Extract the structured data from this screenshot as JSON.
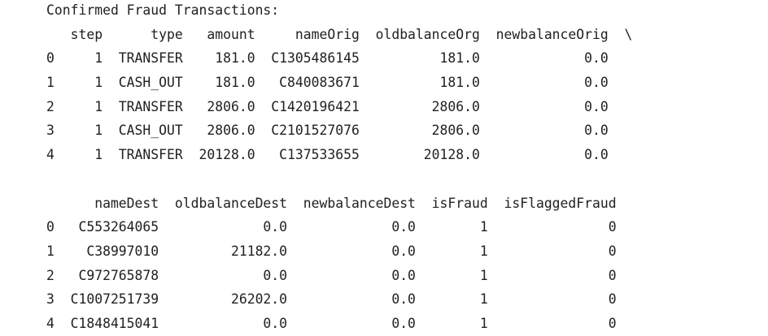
{
  "output": {
    "title": "Confirmed Fraud Transactions:",
    "block1": {
      "header": "   step      type   amount     nameOrig  oldbalanceOrg  newbalanceOrig  \\",
      "rows": [
        "0     1  TRANSFER    181.0  C1305486145          181.0             0.0",
        "1     1  CASH_OUT    181.0   C840083671          181.0             0.0",
        "2     1  TRANSFER   2806.0  C1420196421         2806.0             0.0",
        "3     1  CASH_OUT   2806.0  C2101527076         2806.0             0.0",
        "4     1  TRANSFER  20128.0   C137533655        20128.0             0.0"
      ]
    },
    "block2": {
      "header": "      nameDest  oldbalanceDest  newbalanceDest  isFraud  isFlaggedFraud",
      "rows": [
        "0   C553264065             0.0             0.0        1               0",
        "1    C38997010         21182.0             0.0        1               0",
        "2   C972765878             0.0             0.0        1               0",
        "3  C1007251739         26202.0             0.0        1               0",
        "4  C1848415041             0.0             0.0        1               0"
      ]
    }
  }
}
